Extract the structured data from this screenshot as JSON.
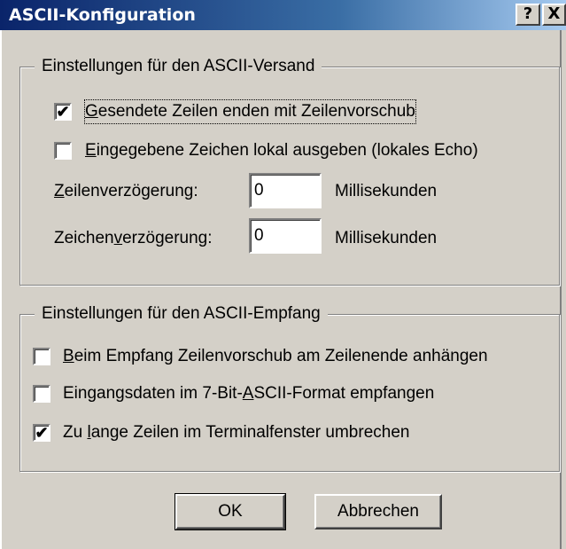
{
  "window": {
    "title": "ASCII-Konfiguration",
    "help_label": "?",
    "close_label": "X"
  },
  "send_group": {
    "legend": "Einstellungen für den ASCII-Versand",
    "opt_linefeed": {
      "checked": true,
      "pre": "",
      "key": "G",
      "post": "esendete Zeilen enden mit Zeilenvorschub"
    },
    "opt_echo": {
      "checked": false,
      "pre": "",
      "key": "E",
      "post": "ingegebene Zeichen lokal ausgeben (lokales Echo)"
    },
    "line_delay": {
      "pre": "",
      "key": "Z",
      "post": "eilenverzögerung:",
      "value": "0",
      "unit": "Millisekunden"
    },
    "char_delay": {
      "pre": "Zeichen",
      "key": "v",
      "post": "erzögerung:",
      "value": "0",
      "unit": "Millisekunden"
    }
  },
  "recv_group": {
    "legend": "Einstellungen für den ASCII-Empfang",
    "opt_append_lf": {
      "checked": false,
      "pre": "",
      "key": "B",
      "post": "eim Empfang Zeilenvorschub am Zeilenende anhängen"
    },
    "opt_7bit": {
      "checked": false,
      "pre": "Eingangsdaten im 7-Bit-",
      "key": "A",
      "post": "SCII-Format empfangen"
    },
    "opt_wrap": {
      "checked": true,
      "pre": "Zu ",
      "key": "l",
      "post": "ange Zeilen im Terminalfenster umbrechen"
    }
  },
  "buttons": {
    "ok_label": "OK",
    "cancel_label": "Abbrechen"
  },
  "check_mark": "✔"
}
